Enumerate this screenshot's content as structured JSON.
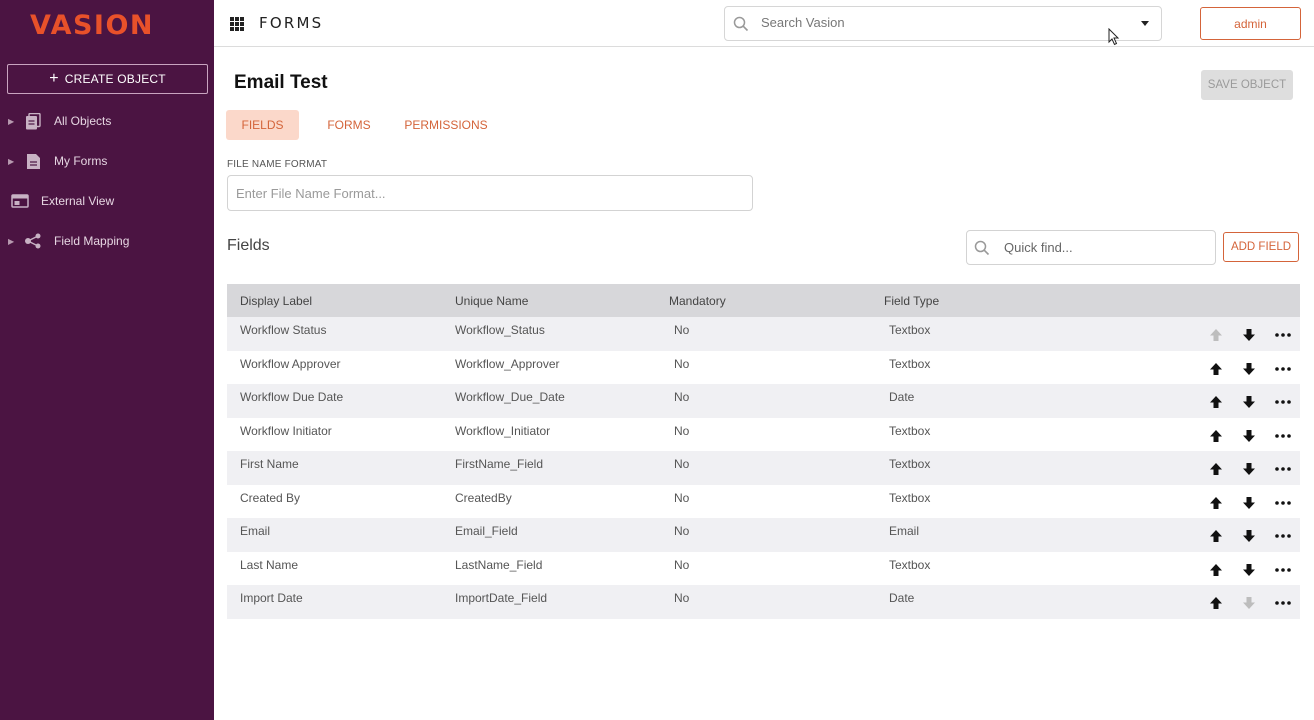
{
  "sidebar": {
    "logo_text": "VASION",
    "create_button": "CREATE OBJECT",
    "items": [
      {
        "label": "All Objects",
        "icon": "documents-icon",
        "expandable": true
      },
      {
        "label": "My Forms",
        "icon": "form-icon",
        "expandable": true
      },
      {
        "label": "External View",
        "icon": "external-view-icon",
        "expandable": false
      },
      {
        "label": "Field Mapping",
        "icon": "field-mapping-icon",
        "expandable": true
      }
    ]
  },
  "header": {
    "app_title": "FORMS",
    "search_placeholder": "Search Vasion",
    "user_button": "admin"
  },
  "main": {
    "title": "Email Test",
    "save_button": "SAVE OBJECT",
    "tabs": [
      {
        "label": "FIELDS",
        "active": true
      },
      {
        "label": "FORMS",
        "active": false
      },
      {
        "label": "PERMISSIONS",
        "active": false
      }
    ],
    "file_name_format": {
      "label": "FILE NAME FORMAT",
      "placeholder": "Enter File Name Format...",
      "value": ""
    },
    "fields_title": "Fields",
    "quick_find_placeholder": "Quick find...",
    "add_field_button": "ADD FIELD",
    "table": {
      "columns": [
        "Display Label",
        "Unique Name",
        "Mandatory",
        "Field Type"
      ],
      "rows": [
        {
          "display_label": "Workflow Status",
          "unique_name": "Workflow_Status",
          "mandatory": "No",
          "field_type": "Textbox",
          "up_enabled": false,
          "down_enabled": true
        },
        {
          "display_label": "Workflow Approver",
          "unique_name": "Workflow_Approver",
          "mandatory": "No",
          "field_type": "Textbox",
          "up_enabled": true,
          "down_enabled": true
        },
        {
          "display_label": "Workflow Due Date",
          "unique_name": "Workflow_Due_Date",
          "mandatory": "No",
          "field_type": "Date",
          "up_enabled": true,
          "down_enabled": true
        },
        {
          "display_label": "Workflow Initiator",
          "unique_name": "Workflow_Initiator",
          "mandatory": "No",
          "field_type": "Textbox",
          "up_enabled": true,
          "down_enabled": true
        },
        {
          "display_label": "First Name",
          "unique_name": "FirstName_Field",
          "mandatory": "No",
          "field_type": "Textbox",
          "up_enabled": true,
          "down_enabled": true
        },
        {
          "display_label": "Created By",
          "unique_name": "CreatedBy",
          "mandatory": "No",
          "field_type": "Textbox",
          "up_enabled": true,
          "down_enabled": true
        },
        {
          "display_label": "Email",
          "unique_name": "Email_Field",
          "mandatory": "No",
          "field_type": "Email",
          "up_enabled": true,
          "down_enabled": true
        },
        {
          "display_label": "Last Name",
          "unique_name": "LastName_Field",
          "mandatory": "No",
          "field_type": "Textbox",
          "up_enabled": true,
          "down_enabled": true
        },
        {
          "display_label": "Import Date",
          "unique_name": "ImportDate_Field",
          "mandatory": "No",
          "field_type": "Date",
          "up_enabled": true,
          "down_enabled": false
        }
      ]
    }
  },
  "colors": {
    "sidebar_bg": "#4b1442",
    "accent": "#d4643a",
    "active_tab_bg": "#fbd8ca",
    "header_row_bg": "#d7d7da"
  }
}
